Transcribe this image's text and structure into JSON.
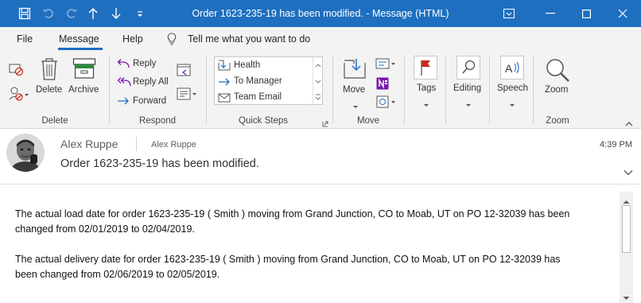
{
  "window": {
    "title": "Order 1623-235-19 has been modified.  -  Message (HTML)"
  },
  "quick_access": [
    "save-icon",
    "undo-icon",
    "redo-icon",
    "up-arrow-icon",
    "down-arrow-icon",
    "customize-qat-icon"
  ],
  "menu": {
    "file": "File",
    "message": "Message",
    "help": "Help",
    "tell_me": "Tell me what you want to do"
  },
  "ribbon": {
    "delete_group": {
      "label": "Delete",
      "delete": "Delete",
      "archive": "Archive"
    },
    "respond_group": {
      "label": "Respond",
      "reply": "Reply",
      "reply_all": "Reply All",
      "forward": "Forward"
    },
    "quick_steps_group": {
      "label": "Quick Steps",
      "items": [
        "Health",
        "To Manager",
        "Team Email"
      ]
    },
    "move_group": {
      "label": "Move",
      "move": "Move"
    },
    "tags": "Tags",
    "editing": "Editing",
    "speech": "Speech",
    "zoom_group": {
      "label": "Zoom",
      "zoom": "Zoom"
    }
  },
  "message": {
    "sender": "Alex Ruppe",
    "sender_display": "Alex Ruppe",
    "time": "4:39 PM",
    "subject": "Order 1623-235-19 has been modified.",
    "paragraphs": [
      {
        "line1": "The actual load date for order 1623-235-19 ( Smith ) moving from Grand Junction, CO to Moab, UT on PO 12-32039 has been",
        "line2": "changed from 02/01/2019 to 02/04/2019."
      },
      {
        "line1": "The actual delivery date for order 1623-235-19 ( Smith ) moving from Grand Junction, CO to Moab, UT on PO 12-32039 has",
        "line2": "been changed from 02/06/2019 to 02/05/2019."
      }
    ]
  },
  "colors": {
    "title_bar": "#1e6fc0",
    "ribbon_bg": "#f3f3f3",
    "accent": "#1e6fc0",
    "flag_red": "#c42b1c",
    "onenote_purple": "#7719aa"
  }
}
